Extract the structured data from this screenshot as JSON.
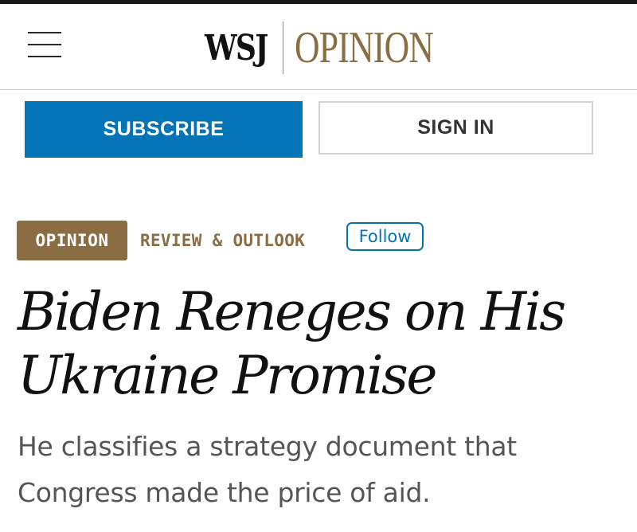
{
  "header": {
    "menu_icon": "hamburger-menu-icon",
    "logo_wsj": "WSJ",
    "logo_section": "OPINION"
  },
  "auth": {
    "subscribe_label": "SUBSCRIBE",
    "signin_label": "SIGN IN"
  },
  "article": {
    "badge": "OPINION",
    "section": "REVIEW & OUTLOOK",
    "follow_label": "Follow",
    "headline": "Biden Reneges on His Ukraine Promise",
    "dek": "He classifies a strategy document that Congress made the price of aid."
  },
  "colors": {
    "brand_blue": "#0274b6",
    "opinion_brown": "#8b6d44",
    "text_dark": "#111111",
    "text_gray": "#555555"
  }
}
